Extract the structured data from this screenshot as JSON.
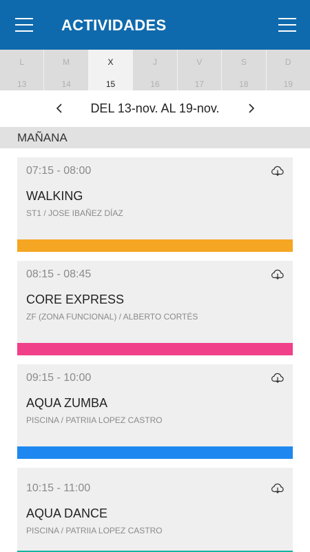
{
  "header": {
    "title": "ACTIVIDADES"
  },
  "days": [
    {
      "letter": "L",
      "num": "13",
      "active": false
    },
    {
      "letter": "M",
      "num": "14",
      "active": false
    },
    {
      "letter": "X",
      "num": "15",
      "active": true
    },
    {
      "letter": "J",
      "num": "16",
      "active": false
    },
    {
      "letter": "V",
      "num": "17",
      "active": false
    },
    {
      "letter": "S",
      "num": "18",
      "active": false
    },
    {
      "letter": "D",
      "num": "19",
      "active": false
    }
  ],
  "range": {
    "label": "DEL 13-nov. AL 19-nov."
  },
  "section": {
    "label": "MAÑANA"
  },
  "activities": [
    {
      "time": "07:15 - 08:00",
      "name": "WALKING",
      "place": "ST1 / JOSE IBAÑEZ DÍAZ",
      "color": "#f5a623",
      "icon": "cloud-download-icon"
    },
    {
      "time": "08:15 - 08:45",
      "name": "CORE EXPRESS",
      "place": "ZF (ZONA FUNCIONAL) / ALBERTO CORTÉS",
      "color": "#f0408a",
      "icon": "cloud-download-icon"
    },
    {
      "time": "09:15 - 10:00",
      "name": "AQUA ZUMBA",
      "place": "PISCINA / PATRIIA LOPEZ CASTRO",
      "color": "#1e88f0",
      "icon": "cloud-download-icon"
    },
    {
      "time": "10:15 - 11:00",
      "name": "AQUA DANCE",
      "place": "PISCINA / PATRIIA LOPEZ CASTRO",
      "color": "#17b3a3",
      "icon": "cloud-download-icon"
    }
  ]
}
